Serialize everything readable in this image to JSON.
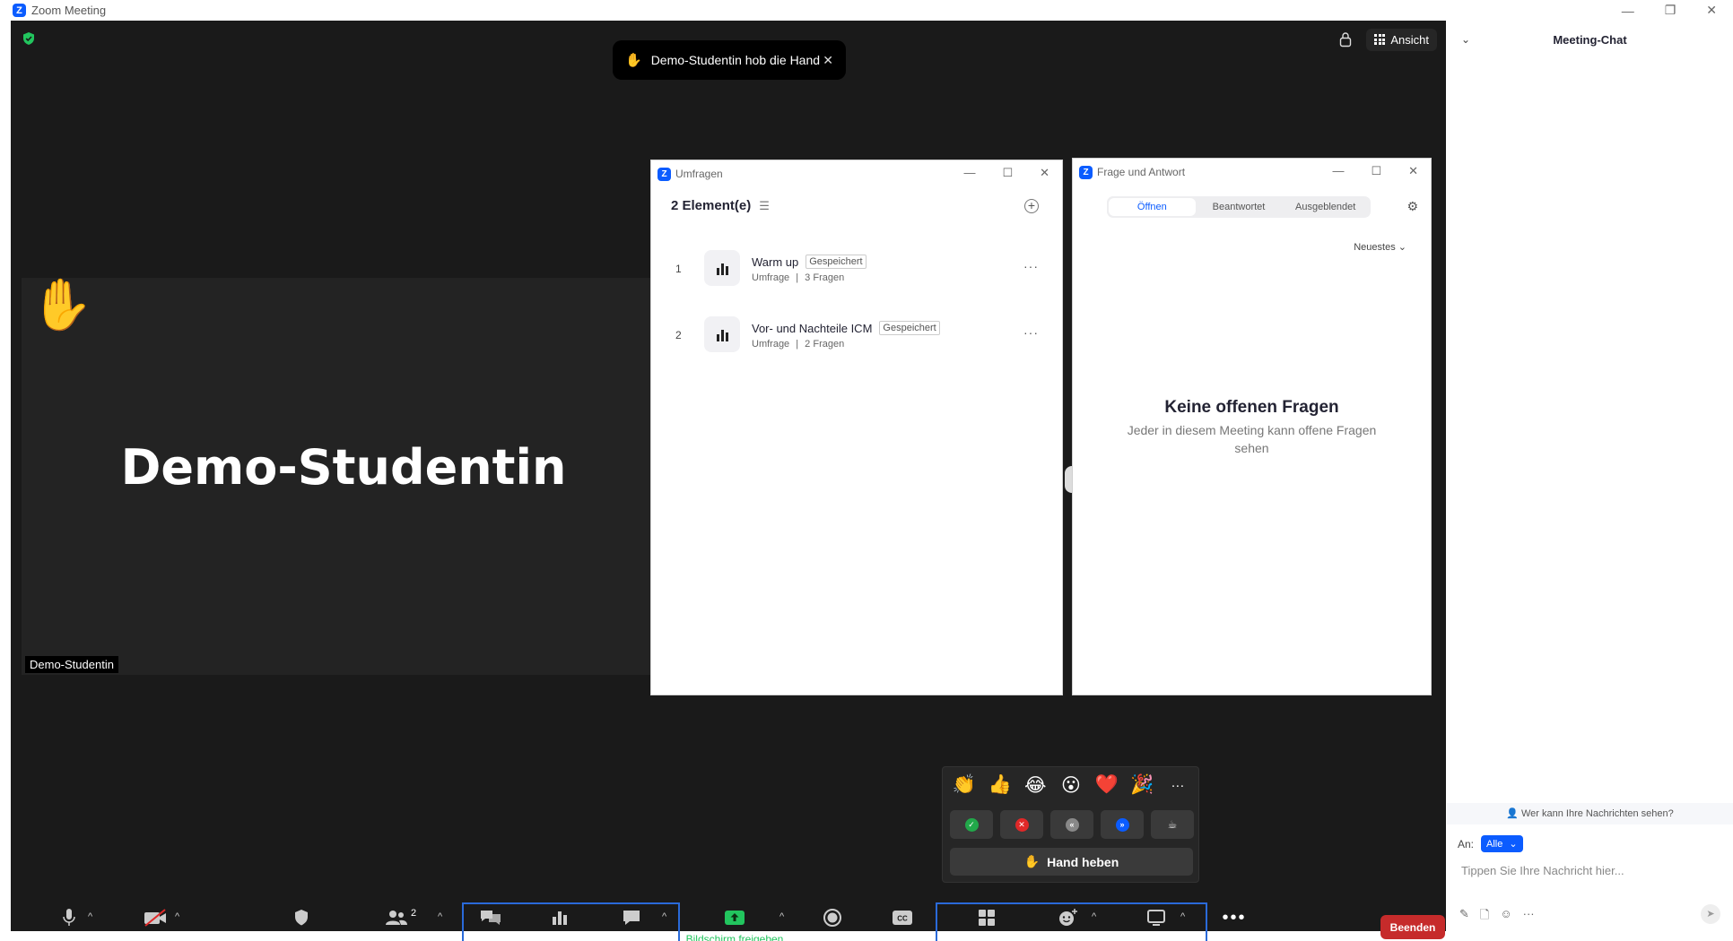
{
  "window": {
    "title": "Zoom Meeting"
  },
  "meeting": {
    "notification": "Demo-Studentin hob die Hand",
    "view_label": "Ansicht",
    "participant_name": "Demo-Studentin",
    "participant_label": "Demo-Studentin"
  },
  "polls": {
    "window_title": "Umfragen",
    "heading": "2 Element(e)",
    "items": [
      {
        "num": "1",
        "title": "Warm up",
        "badge": "Gespeichert",
        "type": "Umfrage",
        "questions": "3 Fragen"
      },
      {
        "num": "2",
        "title": "Vor- und Nachteile ICM",
        "badge": "Gespeichert",
        "type": "Umfrage",
        "questions": "2 Fragen"
      }
    ]
  },
  "qa": {
    "window_title": "Frage und Antwort",
    "tabs": [
      "Öffnen",
      "Beantwortet",
      "Ausgeblendet"
    ],
    "sort": "Neuestes",
    "empty_title": "Keine offenen Fragen",
    "empty_sub": "Jeder in diesem Meeting kann offene Fragen sehen"
  },
  "reactions": {
    "emojis": [
      "👏",
      "👍",
      "😂",
      "😮",
      "❤️",
      "🎉",
      "···"
    ],
    "raise_hand": "Hand heben"
  },
  "toolbar": {
    "mute": "Stummschalten",
    "video": "Video starten",
    "security": "Sicherheit",
    "participants": "Teilnehmer",
    "participants_count": "2",
    "qa": "F&A",
    "polls": "Umfragen",
    "chat": "Chat",
    "share": "Bildschirm freigeben",
    "record": "Aufzeichnen",
    "captions": "Untertitel",
    "breakout": "Breakout Sessions",
    "reactions": "Reaktionen",
    "whiteboards": "Whiteboards",
    "more": "Mehr",
    "end": "Beenden"
  },
  "chat": {
    "title": "Meeting-Chat",
    "who_can_see": "Wer kann Ihre Nachrichten sehen?",
    "to_label": "An:",
    "recipient": "Alle",
    "placeholder": "Tippen Sie Ihre Nachricht hier..."
  },
  "colors": {
    "accent": "#0b5cff",
    "end": "#c62b2b",
    "share": "#22c55e",
    "highlight": "#2a6ad9"
  }
}
